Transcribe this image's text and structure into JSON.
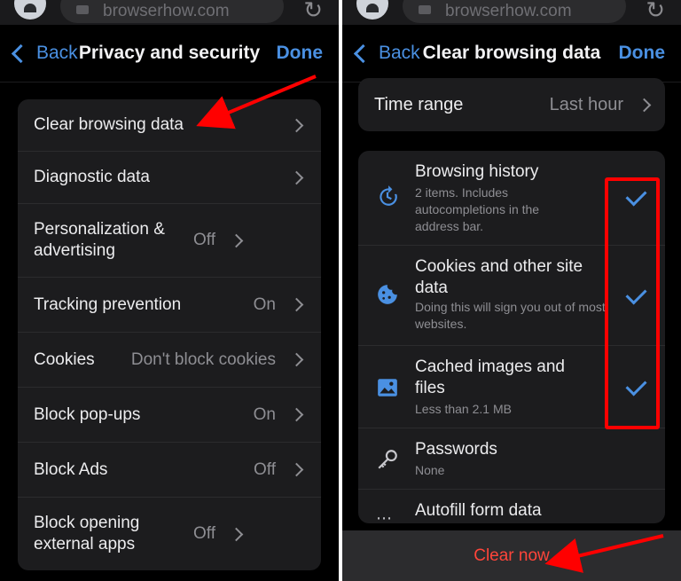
{
  "left": {
    "url": "browserhow.com",
    "back_label": "Back",
    "title": "Privacy and security",
    "done_label": "Done",
    "rows": [
      {
        "label": "Clear browsing data",
        "value": ""
      },
      {
        "label": "Diagnostic data",
        "value": ""
      },
      {
        "label": "Personalization & advertising",
        "value": "Off"
      },
      {
        "label": "Tracking prevention",
        "value": "On"
      },
      {
        "label": "Cookies",
        "value": "Don't block cookies"
      },
      {
        "label": "Block pop-ups",
        "value": "On"
      },
      {
        "label": "Block Ads",
        "value": "Off"
      },
      {
        "label": "Block opening external apps",
        "value": "Off"
      }
    ]
  },
  "right": {
    "url": "browserhow.com",
    "back_label": "Back",
    "title": "Clear browsing data",
    "done_label": "Done",
    "time_range": {
      "label": "Time range",
      "value": "Last hour"
    },
    "items": [
      {
        "name": "Browsing history",
        "desc": "2 items. Includes autocompletions in the address bar.",
        "checked": true,
        "icon": "history-icon"
      },
      {
        "name": "Cookies and other site data",
        "desc": "Doing this will sign you out of most websites.",
        "checked": true,
        "icon": "cookie-icon"
      },
      {
        "name": "Cached images and files",
        "desc": "Less than 2.1 MB",
        "checked": true,
        "icon": "image-icon"
      },
      {
        "name": "Passwords",
        "desc": "None",
        "checked": false,
        "icon": "key-icon"
      },
      {
        "name": "Autofill form data",
        "desc": "",
        "checked": false,
        "icon": "autofill-icon"
      }
    ],
    "clear_label": "Clear now"
  },
  "colors": {
    "accent": "#4a90e2",
    "danger": "#ff453a",
    "annotation": "#ff0000"
  }
}
